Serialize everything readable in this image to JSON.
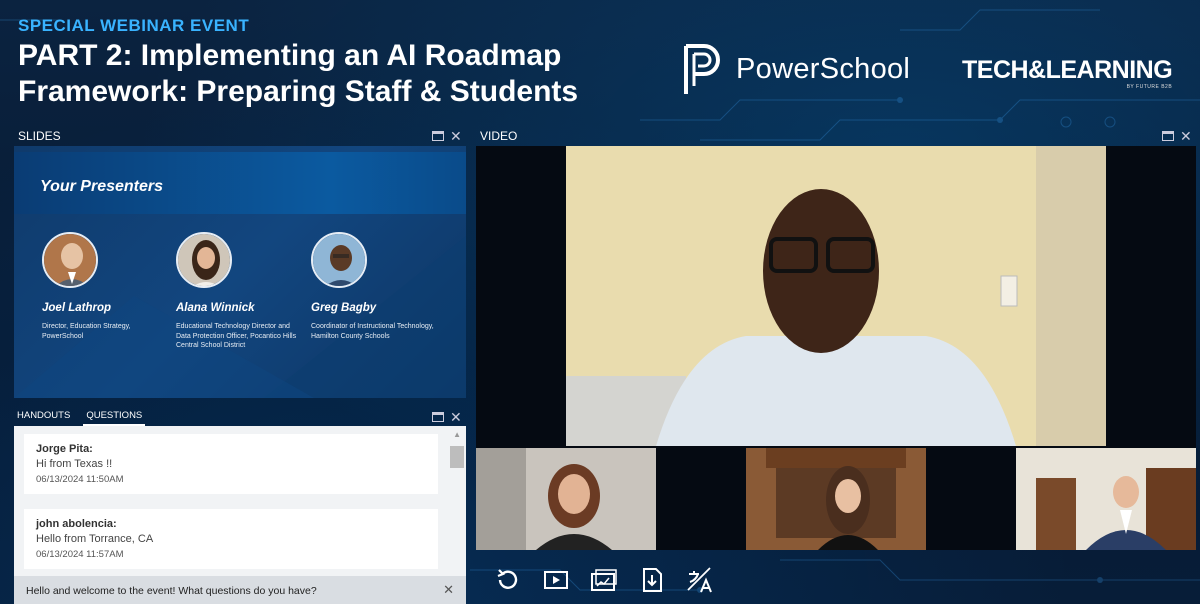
{
  "header": {
    "eyebrow": "SPECIAL WEBINAR EVENT",
    "title_line1": "PART 2: Implementing an AI Roadmap",
    "title_line2": "Framework: Preparing Staff & Students"
  },
  "logos": {
    "powerschool": "PowerSchool",
    "techlearning": "TECH&LEARNING",
    "techlearning_sub": "BY FUTURE B2B"
  },
  "slides_panel": {
    "label": "SLIDES",
    "slide_title": "Your Presenters",
    "presenters": [
      {
        "name": "Joel Lathrop",
        "role": "Director, Education Strategy, PowerSchool"
      },
      {
        "name": "Alana Winnick",
        "role": "Educational Technology Director and Data Protection Officer, Pocantico Hills Central School District"
      },
      {
        "name": "Greg Bagby",
        "role": "Coordinator of Instructional Technology, Hamilton County Schools"
      }
    ]
  },
  "qa_panel": {
    "tabs": [
      "HANDOUTS",
      "QUESTIONS"
    ],
    "active_tab": "QUESTIONS",
    "questions": [
      {
        "author": "Jorge Pita:",
        "text": "Hi from Texas !!",
        "time": "06/13/2024 11:50AM"
      },
      {
        "author": "john abolencia:",
        "text": "Hello from Torrance, CA",
        "time": "06/13/2024 11:57AM"
      }
    ],
    "chat_message": "Hello and welcome to the event! What questions do you have?"
  },
  "video_panel": {
    "label": "VIDEO"
  },
  "toolbar": {
    "buttons": [
      "replay-icon",
      "play-icon",
      "slides-icon",
      "download-icon",
      "translate-icon"
    ]
  },
  "colors": {
    "accent": "#39b3ff",
    "background": "#06162b"
  }
}
